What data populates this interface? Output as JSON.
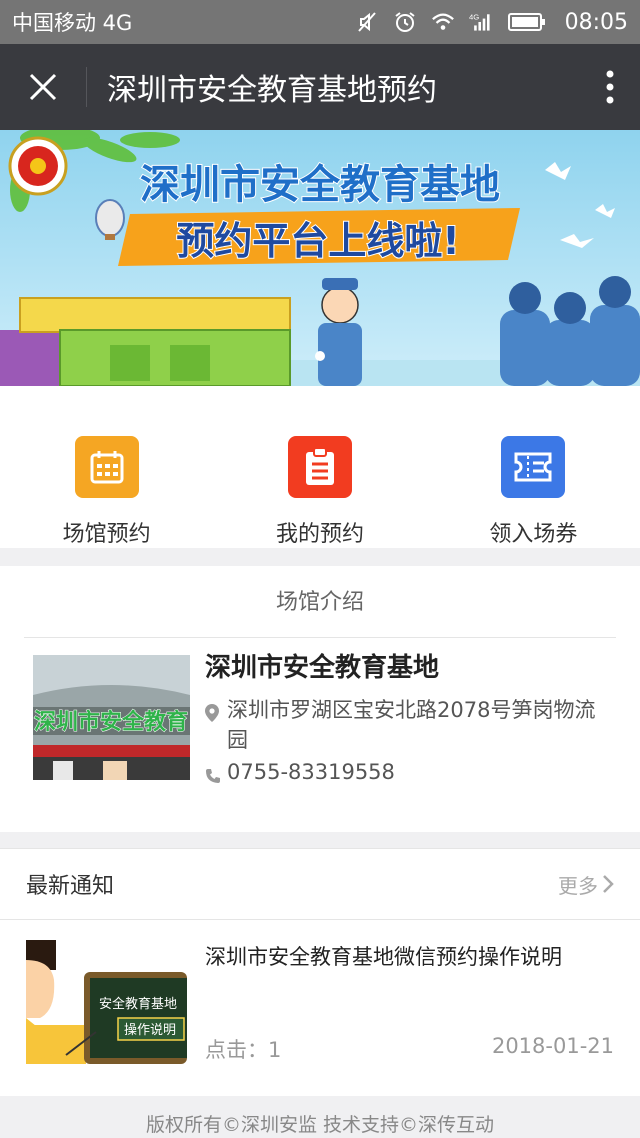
{
  "status_bar": {
    "carrier": "中国移动 4G",
    "time": "08:05",
    "icons": [
      "mute-icon",
      "alarm-icon",
      "wifi-icon",
      "signal-4g-icon",
      "battery-icon"
    ]
  },
  "nav": {
    "title": "深圳市安全教育基地预约",
    "close_icon": "close-icon",
    "more_icon": "more-vertical-icon"
  },
  "banner": {
    "headline": "深圳市安全教育基地",
    "subline": "预约平台上线啦!"
  },
  "actions": [
    {
      "label": "场馆预约",
      "icon": "calendar-icon",
      "color": "#f5a623"
    },
    {
      "label": "我的预约",
      "icon": "clipboard-icon",
      "color": "#f23c20"
    },
    {
      "label": "领入场券",
      "icon": "ticket-icon",
      "color": "#3c78e6"
    }
  ],
  "venue": {
    "section_title": "场馆介绍",
    "name": "深圳市安全教育基地",
    "address": "深圳市罗湖区宝安北路2078号笋岗物流园",
    "phone": "0755-83319558",
    "thumb_text": "深圳市安全教育"
  },
  "news": {
    "section_title": "最新通知",
    "more_label": "更多",
    "items": [
      {
        "title": "深圳市安全教育基地微信预约操作说明",
        "clicks": "点击：1",
        "date": "2018-01-21",
        "board_line1": "安全教育基地",
        "board_line2": "操作说明"
      }
    ]
  },
  "footer": "版权所有©深圳安监  技术支持©深传互动"
}
